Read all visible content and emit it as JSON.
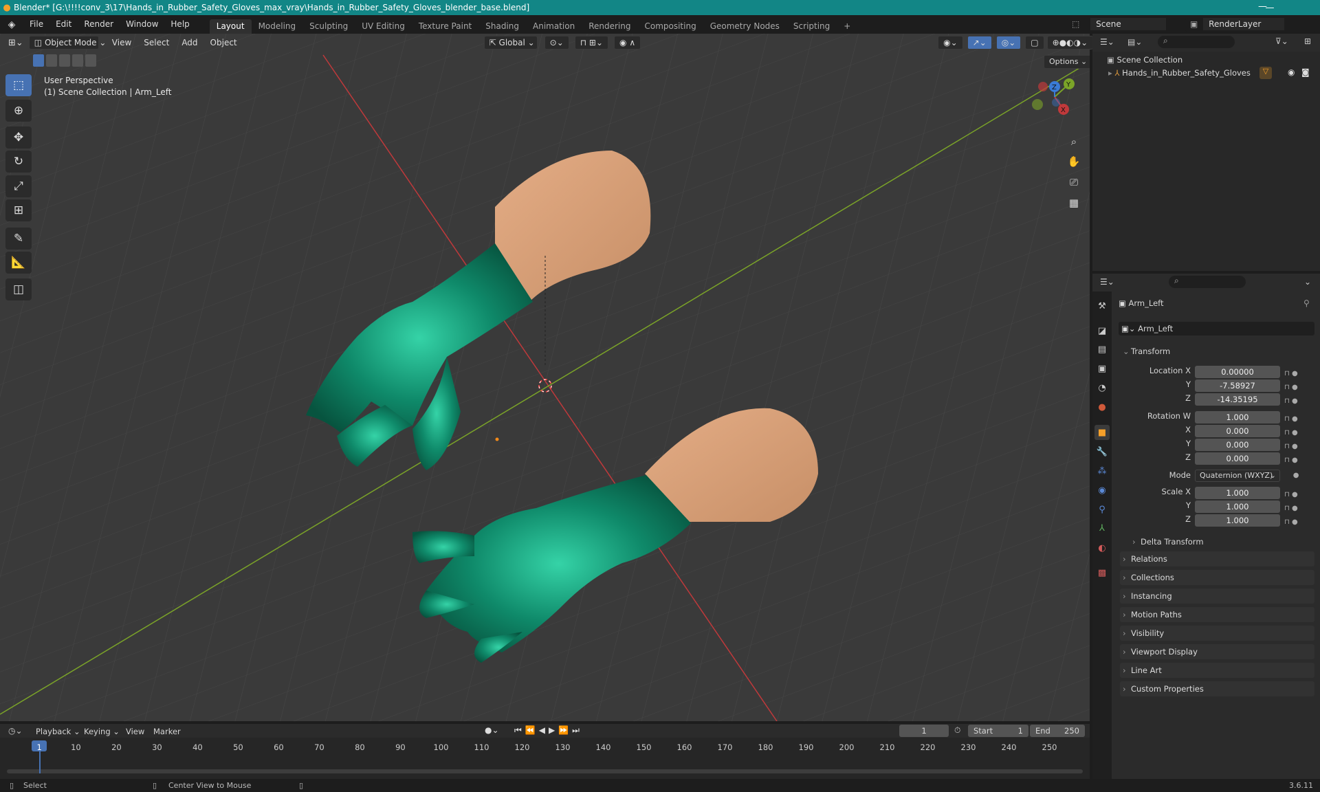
{
  "window": {
    "title": "Blender* [G:\\!!!!conv_3\\17\\Hands_in_Rubber_Safety_Gloves_max_vray\\Hands_in_Rubber_Safety_Gloves_blender_base.blend]",
    "minimize": "—",
    "maximize": "❐",
    "close": "✕"
  },
  "menu": [
    "File",
    "Edit",
    "Render",
    "Window",
    "Help"
  ],
  "workspaces": [
    "Layout",
    "Modeling",
    "Sculpting",
    "UV Editing",
    "Texture Paint",
    "Shading",
    "Animation",
    "Rendering",
    "Compositing",
    "Geometry Nodes",
    "Scripting"
  ],
  "workspace_add": "+",
  "scene": {
    "name": "Scene",
    "view_layer": "RenderLayer"
  },
  "viewport_header": {
    "mode": "Object Mode",
    "menus": [
      "View",
      "Select",
      "Add",
      "Object"
    ],
    "transform_orientation": "Global",
    "options": "Options"
  },
  "viewport": {
    "perspective": "User Perspective",
    "collection_line": "(1) Scene Collection | Arm_Left",
    "gizmo": {
      "x": "X",
      "y": "Y",
      "z": "Z"
    },
    "colors": {
      "background": "#3a3a3a",
      "x_axis": "#c0393b",
      "y_axis": "#7ba428",
      "glove": "#0f8a6a",
      "skin": "#d9a07a"
    }
  },
  "outliner": {
    "root": "Scene Collection",
    "item": "Hands_in_Rubber_Safety_Gloves"
  },
  "properties": {
    "object_name": "Arm_Left",
    "data_name": "Arm_Left",
    "transform_header": "Transform",
    "location": {
      "label": "Location X",
      "x": "0.00000",
      "y": "-7.58927",
      "z": "-14.35195"
    },
    "rotation": {
      "label": "Rotation W",
      "w": "1.000",
      "x": "0.000",
      "y": "0.000",
      "z": "0.000"
    },
    "mode_label": "Mode",
    "mode_value": "Quaternion (WXYZ)",
    "scale": {
      "label": "Scale X",
      "x": "1.000",
      "y": "1.000",
      "z": "1.000"
    },
    "axis_labels": {
      "x": "X",
      "y": "Y",
      "z": "Z"
    },
    "delta_transform": "Delta Transform",
    "panels": [
      "Relations",
      "Collections",
      "Instancing",
      "Motion Paths",
      "Visibility",
      "Viewport Display",
      "Line Art",
      "Custom Properties"
    ]
  },
  "timeline": {
    "menus": [
      "Playback",
      "Keying",
      "View",
      "Marker"
    ],
    "current_frame": "1",
    "start_label": "Start",
    "start": "1",
    "end_label": "End",
    "end": "250",
    "ticks": [
      "1",
      "10",
      "20",
      "30",
      "40",
      "50",
      "60",
      "70",
      "80",
      "90",
      "100",
      "110",
      "120",
      "130",
      "140",
      "150",
      "160",
      "170",
      "180",
      "190",
      "200",
      "210",
      "220",
      "230",
      "240",
      "250"
    ]
  },
  "status": {
    "select": "Select",
    "center": "Center View to Mouse",
    "version": "3.6.11"
  }
}
